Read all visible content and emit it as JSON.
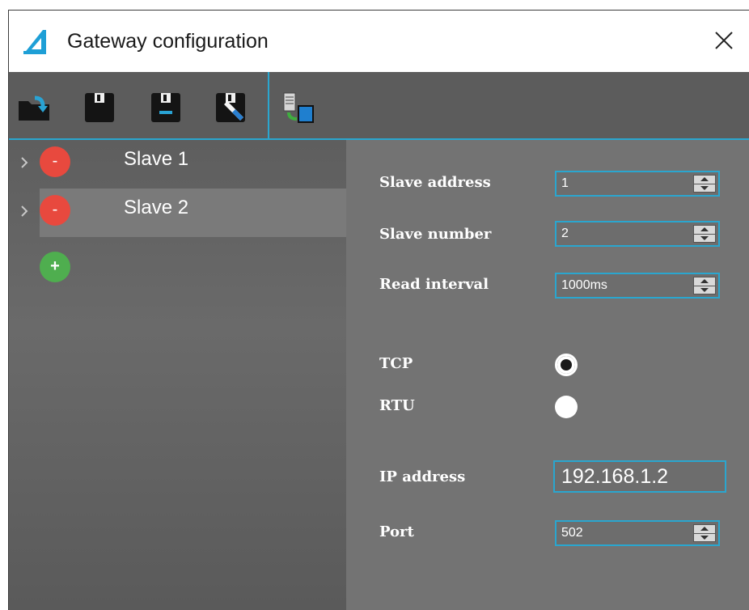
{
  "window": {
    "title": "Gateway configuration"
  },
  "icons": {
    "app": "gateway-logo-icon",
    "close": "close-icon",
    "toolbar": [
      "open-folder-icon",
      "save-icon",
      "save-as-icon",
      "save-edit-icon",
      "transfer-to-device-icon"
    ]
  },
  "colors": {
    "accent": "#2aa6cf",
    "remove": "#e8493e",
    "add": "#4fae4f",
    "panel": "#737373",
    "toolbar": "#5c5c5c"
  },
  "slaves": [
    {
      "label": "Slave 1",
      "remove_symbol": "-"
    },
    {
      "label": "Slave 2",
      "remove_symbol": "-"
    }
  ],
  "add_symbol": "+",
  "form": {
    "slave_address": {
      "label": "Slave address",
      "value": "1"
    },
    "slave_number": {
      "label": "Slave number",
      "value": "2"
    },
    "read_interval": {
      "label": "Read interval",
      "value": "1000ms"
    },
    "tcp": {
      "label": "TCP",
      "selected": true
    },
    "rtu": {
      "label": "RTU",
      "selected": false
    },
    "ip_address": {
      "label": "IP address",
      "value": "192.168.1.2"
    },
    "port": {
      "label": "Port",
      "value": "502"
    }
  }
}
